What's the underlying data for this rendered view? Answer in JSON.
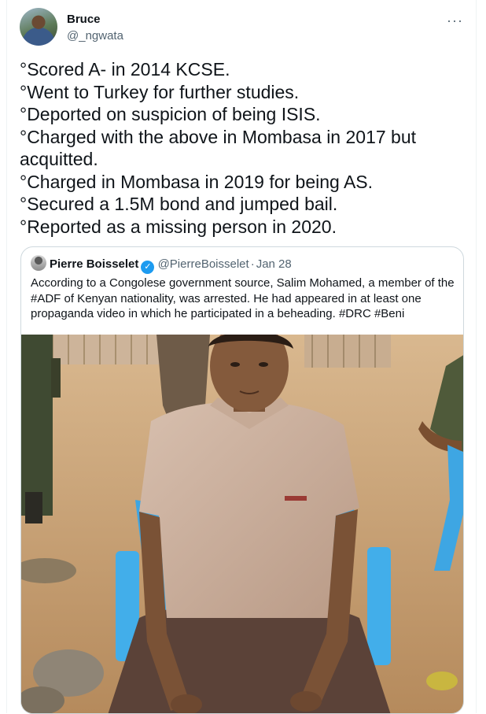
{
  "tweet": {
    "author": {
      "name": "Bruce",
      "handle": "@_ngwata"
    },
    "more_icon": "more-horizontal-icon",
    "lines": [
      "°Scored A- in 2014 KCSE.",
      "°Went to Turkey for further studies.",
      "°Deported on suspicion of being ISIS.",
      "°Charged with the above in Mombasa in 2017 but acquitted.",
      "°Charged in Mombasa in 2019 for being AS.",
      "°Secured a 1.5M bond and jumped bail.",
      "°Reported as a missing person in 2020."
    ]
  },
  "quoted_tweet": {
    "author": {
      "name": "Pierre Boisselet",
      "handle": "@PierreBoisselet",
      "verified": true
    },
    "separator": "·",
    "date": "Jan 28",
    "text": "According to a Congolese government source, Salim Mohamed, a member of the #ADF of Kenyan nationality, was arrested. He had appeared in at least one propaganda video in which he participated in a beheading. #DRC #Beni",
    "media": {
      "type": "photo"
    }
  },
  "colors": {
    "text": "#0f1419",
    "secondary": "#536471",
    "border": "#cfd9de",
    "verified": "#1d9bf0"
  }
}
